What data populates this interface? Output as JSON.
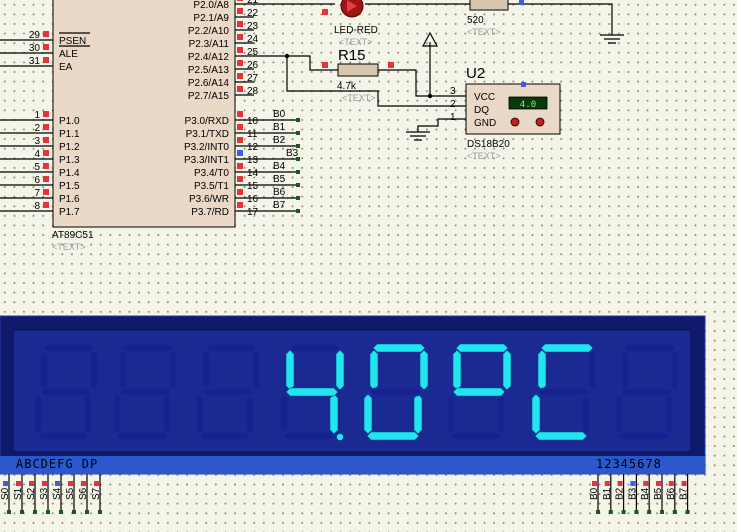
{
  "mcu": {
    "name": "AT89C51",
    "placeholder": "<TEXT>",
    "left_pins": [
      {
        "num": "29",
        "label": "PSEN"
      },
      {
        "num": "30",
        "label": "ALE"
      },
      {
        "num": "31",
        "label": "EA"
      },
      {
        "num": "1",
        "label": "P1.0"
      },
      {
        "num": "2",
        "label": "P1.1"
      },
      {
        "num": "3",
        "label": "P1.2"
      },
      {
        "num": "4",
        "label": "P1.3"
      },
      {
        "num": "5",
        "label": "P1.4"
      },
      {
        "num": "6",
        "label": "P1.5"
      },
      {
        "num": "7",
        "label": "P1.6"
      },
      {
        "num": "8",
        "label": "P1.7"
      }
    ],
    "right_pins_p2": [
      {
        "num": "21",
        "label": "P2.0/A8"
      },
      {
        "num": "22",
        "label": "P2.1/A9"
      },
      {
        "num": "23",
        "label": "P2.2/A10"
      },
      {
        "num": "24",
        "label": "P2.3/A11"
      },
      {
        "num": "25",
        "label": "P2.4/A12"
      },
      {
        "num": "26",
        "label": "P2.5/A13"
      },
      {
        "num": "27",
        "label": "P2.6/A14"
      },
      {
        "num": "28",
        "label": "P2.7/A15"
      }
    ],
    "right_pins_p3": [
      {
        "num": "10",
        "label": "P3.0/RXD",
        "net": "B0"
      },
      {
        "num": "11",
        "label": "P3.1/TXD",
        "net": "B1"
      },
      {
        "num": "12",
        "label": "P3.2/INT0",
        "net": "B2"
      },
      {
        "num": "13",
        "label": "P3.3/INT1",
        "net": "B3"
      },
      {
        "num": "14",
        "label": "P3.4/T0",
        "net": "B4"
      },
      {
        "num": "15",
        "label": "P3.5/T1",
        "net": "B5"
      },
      {
        "num": "16",
        "label": "P3.6/WR",
        "net": "B6"
      },
      {
        "num": "17",
        "label": "P3.7/RD",
        "net": "B7"
      }
    ]
  },
  "led": {
    "name": "LED-RED",
    "placeholder": "<TEXT>"
  },
  "resistor_top": {
    "value": "520",
    "placeholder": "<TEXT>"
  },
  "r15": {
    "ref": "R15",
    "value": "4.7k",
    "placeholder": "<TEXT>"
  },
  "sensor": {
    "ref": "U2",
    "name": "DS18B20",
    "placeholder": "<TEXT>",
    "reading": "4.0",
    "pins": [
      {
        "num": "3",
        "label": "VCC"
      },
      {
        "num": "2",
        "label": "DQ"
      },
      {
        "num": "1",
        "label": "GND"
      }
    ]
  },
  "display": {
    "digits": [
      "",
      "",
      "",
      "4",
      "0",
      "°",
      "C",
      ""
    ],
    "decimal_point_after_digit": 3,
    "segment_label": "ABCDEFG  DP",
    "digit_label": "12345678",
    "bottom_left_nets": [
      "S0",
      "S1",
      "S2",
      "S3",
      "S4",
      "S5",
      "S6",
      "S7"
    ],
    "bottom_right_nets": [
      "B0",
      "B1",
      "B2",
      "B3",
      "B4",
      "B5",
      "B6",
      "B7"
    ],
    "colors": {
      "lit": "#22e6ee",
      "unlit": "#16238f",
      "panel": "#1b2a92",
      "bezel": "#101a6a"
    }
  }
}
